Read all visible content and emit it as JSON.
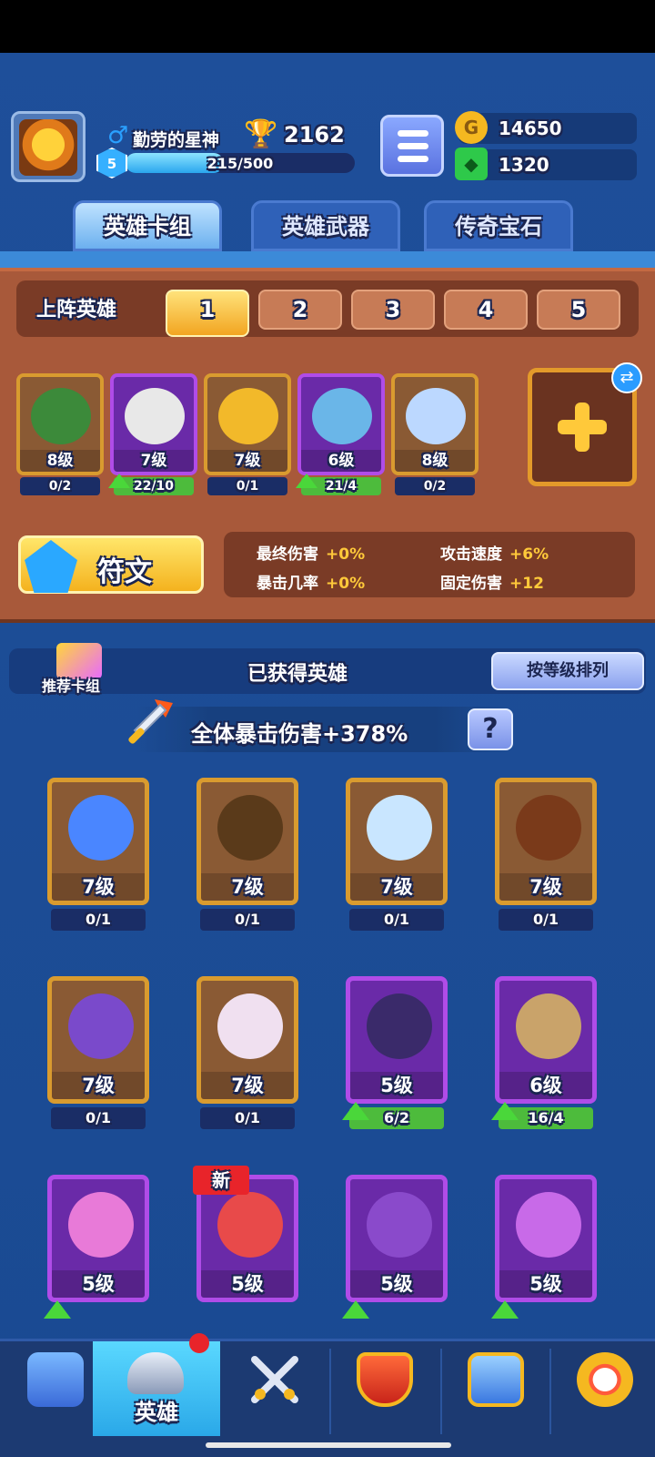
{
  "header": {
    "gender_symbol": "♂",
    "player_name": "勤劳的星神",
    "trophies": "2162",
    "level": "5",
    "xp_text": "215/500",
    "xp_fraction": 0.43,
    "gold": "14650",
    "gems": "1320"
  },
  "tabs": [
    {
      "label": "英雄卡组"
    },
    {
      "label": "英雄武器"
    },
    {
      "label": "传奇宝石"
    }
  ],
  "deck": {
    "label": "上阵英雄",
    "slots": [
      "1",
      "2",
      "3",
      "4",
      "5"
    ],
    "heroes": [
      {
        "level": "8级",
        "progress": "0/2",
        "rarity": "gold",
        "upgradable": false,
        "color": "#3c8a3a"
      },
      {
        "level": "7级",
        "progress": "22/10",
        "rarity": "purple",
        "upgradable": true,
        "color": "#e8e8e8"
      },
      {
        "level": "7级",
        "progress": "0/1",
        "rarity": "gold",
        "upgradable": false,
        "color": "#f2b92a"
      },
      {
        "level": "6级",
        "progress": "21/4",
        "rarity": "purple",
        "upgradable": true,
        "color": "#6ab6e8"
      },
      {
        "level": "8级",
        "progress": "0/2",
        "rarity": "gold",
        "upgradable": false,
        "color": "#bcd8ff"
      }
    ],
    "rune_label": "符文",
    "stats": [
      {
        "label": "最终伤害",
        "value": "+0%"
      },
      {
        "label": "攻击速度",
        "value": "+6%"
      },
      {
        "label": "暴击几率",
        "value": "+0%"
      },
      {
        "label": "固定伤害",
        "value": "+12"
      }
    ]
  },
  "owned": {
    "recommend_label": "推荐卡组",
    "title": "已获得英雄",
    "sort_label": "按等级排列",
    "crit_text": "全体暴击伤害+378%",
    "help_label": "?",
    "new_label": "新",
    "heroes": [
      {
        "level": "7级",
        "progress": "0/1",
        "rarity": "gold",
        "upgradable": false,
        "color": "#4a86ff",
        "is_new": false
      },
      {
        "level": "7级",
        "progress": "0/1",
        "rarity": "gold",
        "upgradable": false,
        "color": "#5a3a1a",
        "is_new": false
      },
      {
        "level": "7级",
        "progress": "0/1",
        "rarity": "gold",
        "upgradable": false,
        "color": "#c9e6ff",
        "is_new": false
      },
      {
        "level": "7级",
        "progress": "0/1",
        "rarity": "gold",
        "upgradable": false,
        "color": "#7a3a1a",
        "is_new": false
      },
      {
        "level": "7级",
        "progress": "0/1",
        "rarity": "gold",
        "upgradable": false,
        "color": "#7a4acb",
        "is_new": false
      },
      {
        "level": "7级",
        "progress": "0/1",
        "rarity": "gold",
        "upgradable": false,
        "color": "#f0e0f0",
        "is_new": false
      },
      {
        "level": "5级",
        "progress": "6/2",
        "rarity": "purple",
        "upgradable": true,
        "color": "#3a2a6a",
        "is_new": false
      },
      {
        "level": "6级",
        "progress": "16/4",
        "rarity": "purple",
        "upgradable": true,
        "color": "#c9a36a",
        "is_new": false
      },
      {
        "level": "5级",
        "progress": "",
        "rarity": "purple",
        "upgradable": true,
        "color": "#e87ad8",
        "is_new": false
      },
      {
        "level": "5级",
        "progress": "",
        "rarity": "purple",
        "upgradable": false,
        "color": "#e84a4a",
        "is_new": true
      },
      {
        "level": "5级",
        "progress": "",
        "rarity": "purple",
        "upgradable": true,
        "color": "#8a4acb",
        "is_new": false
      },
      {
        "level": "5级",
        "progress": "",
        "rarity": "purple",
        "upgradable": true,
        "color": "#c86ae8",
        "is_new": false
      }
    ]
  },
  "nav": [
    {
      "label": "",
      "icon": "treasure-chest-icon"
    },
    {
      "label": "英雄",
      "icon": "knight-helmet-icon"
    },
    {
      "label": "",
      "icon": "crossed-swords-icon"
    },
    {
      "label": "",
      "icon": "crown-shield-icon"
    },
    {
      "label": "",
      "icon": "friends-icon"
    },
    {
      "label": "",
      "icon": "compass-icon"
    }
  ],
  "colors": {
    "gold_card": "#d99b2f",
    "purple_card": "#b04ce8",
    "deck_bg": "#a8593a",
    "accent_yellow": "#ffc93a"
  }
}
